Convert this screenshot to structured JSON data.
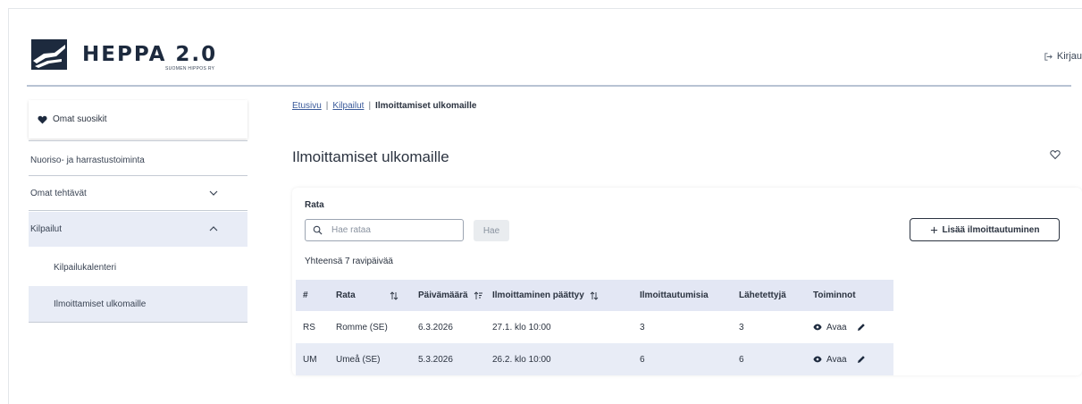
{
  "header": {
    "logo_title": "HEPPA 2.0",
    "logo_subtitle": "SUOMEN HIPPOS RY",
    "login_label": "Kirjau"
  },
  "sidebar": {
    "favorites_label": "Omat suosikit",
    "items": [
      {
        "label": "Nuoriso- ja harrastustoiminta"
      },
      {
        "label": "Omat tehtävät"
      },
      {
        "label": "Kilpailut"
      }
    ],
    "subitems": [
      {
        "label": "Kilpailukalenteri"
      },
      {
        "label": "Ilmoittamiset ulkomaille"
      }
    ]
  },
  "breadcrumb": {
    "home": "Etusivu",
    "section": "Kilpailut",
    "current": "Ilmoittamiset ulkomaille",
    "separator": "|"
  },
  "page": {
    "title": "Ilmoittamiset ulkomaille"
  },
  "filter": {
    "rata_label": "Rata",
    "search_placeholder": "Hae rataa",
    "search_button": "Hae",
    "add_button": "Lisää ilmoittautuminen",
    "total_text": "Yhteensä 7 ravipäivää"
  },
  "table": {
    "headers": [
      "#",
      "Rata",
      "Päivämäärä",
      "Ilmoittaminen päättyy",
      "Ilmoittautumisia",
      "Lähetettyjä",
      "Toiminnot"
    ],
    "rows": [
      {
        "code": "RS",
        "track": "Romme (SE)",
        "date": "6.3.2026",
        "deadline": "27.1. klo 10:00",
        "registrations": "3",
        "sent": "3",
        "open": "Avaa"
      },
      {
        "code": "UM",
        "track": "Umeå (SE)",
        "date": "5.3.2026",
        "deadline": "26.2. klo 10:00",
        "registrations": "6",
        "sent": "6",
        "open": "Avaa"
      }
    ]
  },
  "colors": {
    "header_row": "#e3e7f4",
    "alt_row": "#e8ecf6",
    "text": "#2b3340",
    "link": "#3a5a9a"
  }
}
